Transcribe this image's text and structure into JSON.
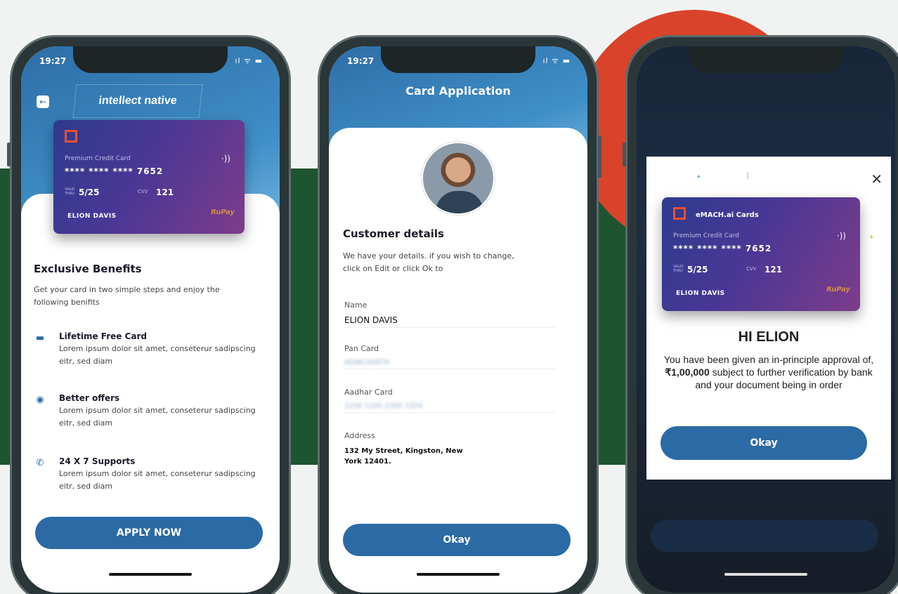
{
  "status": {
    "time": "19:27",
    "icons": "ıl ᯤ ▬"
  },
  "card": {
    "brand": "eMACH.ai Cards",
    "type": "Premium Credit Card",
    "number": "**** **** **** 7652",
    "valid_label": "VALID THRU",
    "valid": "5/25",
    "cvv_label": "CVV",
    "cvv": "121",
    "holder": "ELION DAVIS",
    "nfc": "·))",
    "network": "RuPay"
  },
  "screen1": {
    "brand_label": "intellect native",
    "title": "Exclusive Benefits",
    "subtitle": "Get your card in two simple steps and enjoy the following benifits",
    "benefits": [
      {
        "title": "Lifetime Free Card",
        "desc": "Lorem ipsum dolor sit amet, conseterur sadipscing eitr, sed diam"
      },
      {
        "title": "Better offers",
        "desc": "Lorem ipsum dolor sit amet, conseterur sadipscing eitr, sed diam"
      },
      {
        "title": "24 X 7 Supports",
        "desc": "Lorem ipsum dolor sit amet, conseterur sadipscing eitr, sed diam"
      }
    ],
    "apply_label": "APPLY NOW"
  },
  "screen2": {
    "header_title": "Card Application",
    "section_title": "Customer details",
    "subtitle": "We have your details. if you wish to change, click on Edit or click Ok to",
    "fields": [
      {
        "label": "Name",
        "value": "ELION DAVIS"
      },
      {
        "label": "Pan Card",
        "value": "ADWCA5879"
      },
      {
        "label": "Aadhar Card",
        "value": "1234 1245 2345 2324"
      },
      {
        "label": "Address",
        "value": "132 My Street, Kingston, New York 12401."
      }
    ],
    "okay_label": "Okay"
  },
  "screen3": {
    "greeting": "HI ELION",
    "message_pre": "You have been given an in-principle approval of, ",
    "amount": "₹1,00,000",
    "message_post": " subject to further verification by bank and your document being in order",
    "okay_label": "Okay",
    "close": "✕"
  },
  "colors": {
    "primary": "#2c6aa5",
    "green": "#1e5530",
    "red": "#d9432b",
    "card_accent": "#e8502f"
  }
}
